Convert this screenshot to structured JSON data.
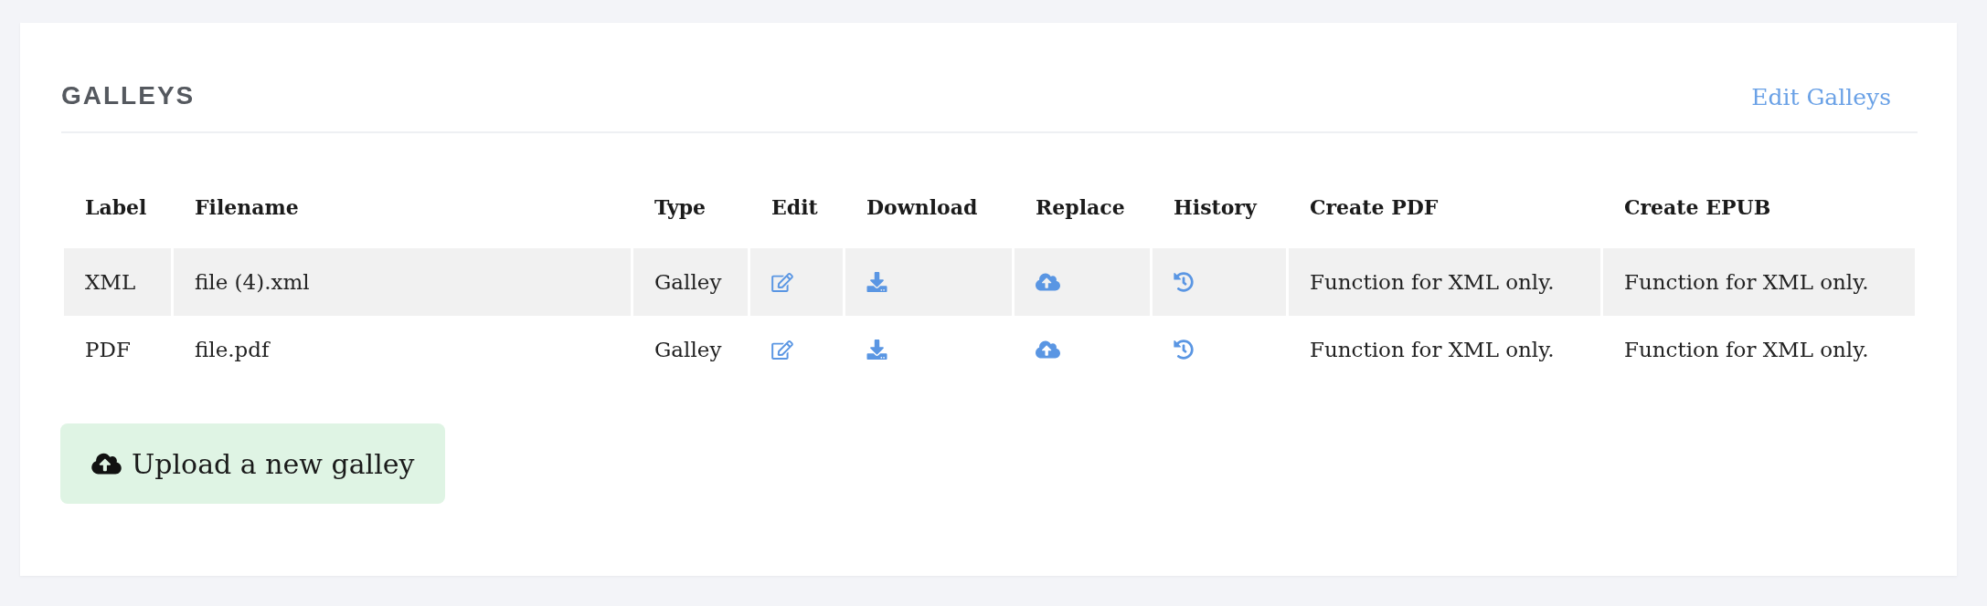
{
  "section": {
    "title": "GALLEYS",
    "edit_link": "Edit Galleys"
  },
  "table": {
    "columns": [
      "Label",
      "Filename",
      "Type",
      "Edit",
      "Download",
      "Replace",
      "History",
      "Create PDF",
      "Create EPUB"
    ],
    "rows": [
      {
        "label": "XML",
        "filename": "file (4).xml",
        "type": "Galley",
        "create_pdf": "Function for XML only.",
        "create_epub": "Function for XML only."
      },
      {
        "label": "PDF",
        "filename": "file.pdf",
        "type": "Galley",
        "create_pdf": "Function for XML only.",
        "create_epub": "Function for XML only."
      }
    ]
  },
  "upload_button": {
    "label": "Upload a new galley"
  }
}
